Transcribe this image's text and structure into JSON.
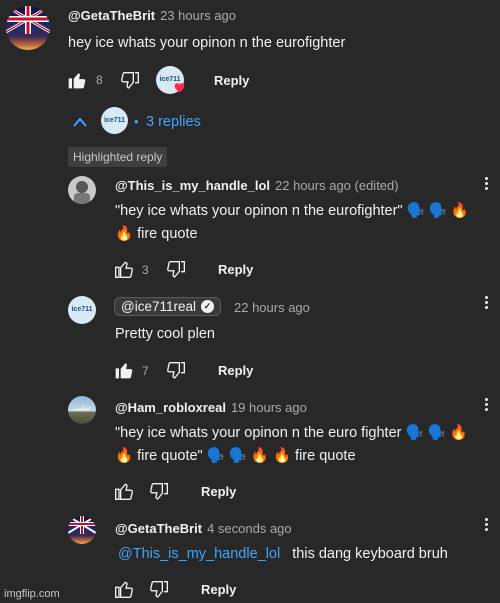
{
  "top_comment": {
    "handle": "@GetaTheBrit",
    "time": "23 hours ago",
    "text": "hey ice whats your opinon n the eurofighter",
    "likes": "8",
    "reply_label": "Reply",
    "creator_avatar_label": "ice711"
  },
  "replies_toggle": {
    "avatar_label": "ice711",
    "dot": "•",
    "label": "3 replies"
  },
  "highlighted": {
    "label": "Highlighted reply"
  },
  "replies": [
    {
      "handle": "@This_is_my_handle_lol",
      "time": "22 hours ago (edited)",
      "line1": "\"hey ice whats your opinon n the eurofighter\" 🗣️ 🗣️ 🔥",
      "line2": "🔥 fire quote",
      "likes": "3",
      "reply_label": "Reply"
    },
    {
      "handle": "@ice711real",
      "verified_mark": "✓",
      "time": "22 hours ago",
      "text": "Pretty cool plen",
      "likes": "7",
      "reply_label": "Reply",
      "avatar_label": "ice711"
    },
    {
      "handle": "@Ham_robloxreal",
      "time": "19 hours ago",
      "line1": "\"hey ice whats your opinon n the euro fighter 🗣️ 🗣️ 🔥",
      "line2": "🔥 fire quote\" 🗣️ 🗣️ 🔥 🔥 fire quote",
      "reply_label": "Reply"
    },
    {
      "handle": "@GetaTheBrit",
      "time": "4 seconds ago",
      "mention": "@This_is_my_handle_lol",
      "text": "this dang keyboard bruh",
      "reply_label": "Reply"
    }
  ],
  "watermark": "imgflip.com",
  "icons": [
    "thumb-up-icon",
    "thumb-down-icon",
    "heart-icon",
    "chevron-up-icon",
    "more-vert-icon",
    "verified-check-icon"
  ],
  "colors": {
    "background": "#282828",
    "link": "#3ea6ff",
    "heart": "#ff2a4a",
    "muted": "#aaaaaa"
  }
}
